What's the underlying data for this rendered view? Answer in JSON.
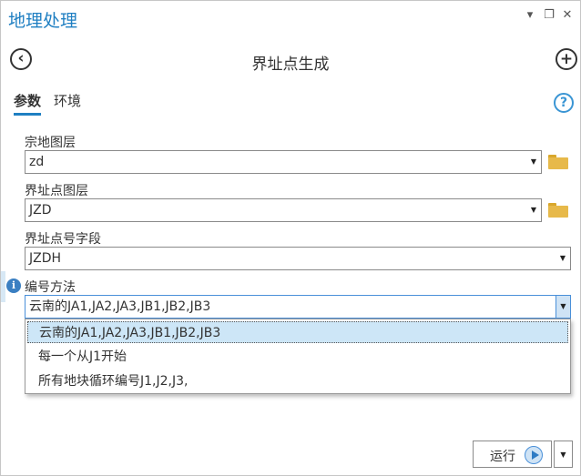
{
  "window": {
    "title": "地理处理",
    "controls": [
      "▾",
      "❐",
      "✕"
    ]
  },
  "tool": {
    "title": "界址点生成",
    "back_icon": "back-circle-icon",
    "add_icon": "add-circle-icon"
  },
  "tabs": [
    {
      "label": "参数",
      "active": true
    },
    {
      "label": "环境",
      "active": false
    }
  ],
  "help": {
    "glyph": "?"
  },
  "params": [
    {
      "label": "宗地图层",
      "value": "zd",
      "has_browse": true
    },
    {
      "label": "界址点图层",
      "value": "JZD",
      "has_browse": true
    },
    {
      "label": "界址点号字段",
      "value": "JZDH",
      "has_browse": false
    },
    {
      "label": "编号方法",
      "value": "云南的JA1,JA2,JA3,JB1,JB2,JB3",
      "has_browse": false,
      "open": true
    }
  ],
  "info_glyph": "i",
  "dropdown_options": [
    {
      "label": "云南的JA1,JA2,JA3,JB1,JB2,JB3",
      "selected": true
    },
    {
      "label": "每一个从J1开始",
      "selected": false
    },
    {
      "label": "所有地块循环编号J1,J2,J3,",
      "selected": false
    }
  ],
  "run": {
    "label": "运行"
  },
  "colors": {
    "accent": "#1f7fc2",
    "selection": "#cde6f7",
    "folder": "#e7b94a"
  }
}
